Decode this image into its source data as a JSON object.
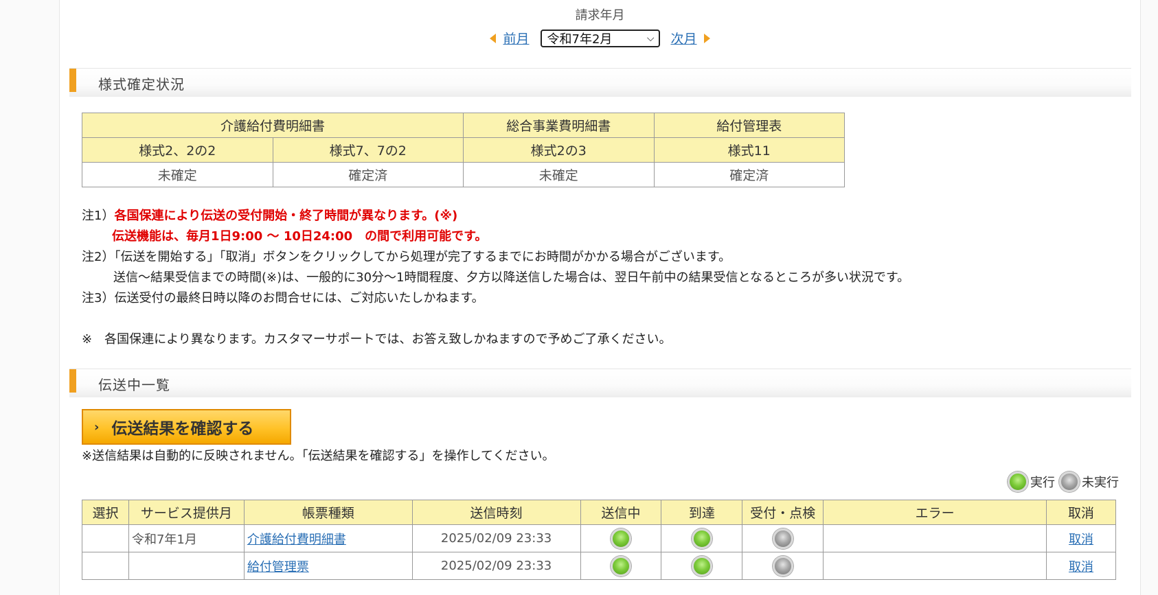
{
  "month_selector": {
    "title": "請求年月",
    "prev_label": "前月",
    "next_label": "次月",
    "selected_month": "令和7年2月"
  },
  "status_section": {
    "title": "様式確定状況",
    "groups": [
      "介護給付費明細書",
      "総合事業費明細書",
      "給付管理表"
    ],
    "forms": [
      "様式2、2の2",
      "様式7、7の2",
      "様式2の3",
      "様式11"
    ],
    "statuses": [
      "未確定",
      "確定済",
      "未確定",
      "確定済"
    ]
  },
  "notes": {
    "note1_prefix": "注1）",
    "note1_red": "各国保連により伝送の受付開始・終了時間が異なります。(※)",
    "note1_red2": "伝送機能は、毎月1日9:00 ～ 10日24:00　の間で利用可能です。",
    "note2": "注2）「伝送を開始する」「取消」ボタンをクリックしてから処理が完了するまでにお時間がかかる場合がございます。",
    "note2b": "送信～結果受信までの時間(※)は、一般的に30分～1時間程度、夕方以降送信した場合は、翌日午前中の結果受信となるところが多い状況です。",
    "note3": "注3）伝送受付の最終日時以降のお問合せには、ご対応いたしかねます。",
    "footnote": "※　各国保連により異なります。カスタマーサポートでは、お答え致しかねますので予めご了承ください。"
  },
  "transmission_section": {
    "title": "伝送中一覧",
    "confirm_button": "伝送結果を確認する",
    "confirm_note": "※送信結果は自動的に反映されません。「伝送結果を確認する」を操作してください。",
    "legend_executed": "実行",
    "legend_not_executed": "未実行",
    "columns": [
      "選択",
      "サービス提供月",
      "帳票種類",
      "送信時刻",
      "送信中",
      "到達",
      "受付・点検",
      "エラー",
      "取消"
    ],
    "rows": [
      {
        "service_month": "令和7年1月",
        "form_type": "介護給付費明細書",
        "sent_time": "2025/02/09 23:33",
        "sending": "executed",
        "arrived": "executed",
        "accepted": "not_executed",
        "error": "",
        "cancel": "取消"
      },
      {
        "service_month": "",
        "form_type": "給付管理票",
        "sent_time": "2025/02/09 23:33",
        "sending": "executed",
        "arrived": "executed",
        "accepted": "not_executed",
        "error": "",
        "cancel": "取消"
      }
    ]
  },
  "colors": {
    "accent_orange": "#f0a020",
    "header_yellow": "#fbf3b0",
    "link_blue": "#2a6fb5",
    "warning_red": "#e00000"
  }
}
